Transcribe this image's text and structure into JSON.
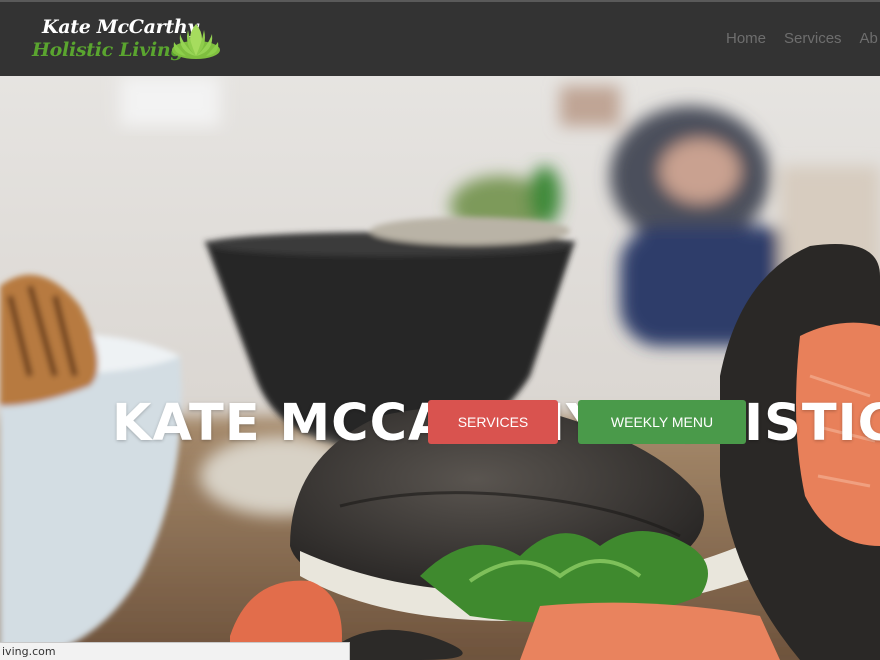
{
  "navbar": {
    "logo_line1": "Kate McCarthy",
    "logo_line2": "Holistic Living",
    "links": [
      "Home",
      "Services",
      "Ab"
    ]
  },
  "hero": {
    "title": "KATE MCCARTHY HOLISTIC",
    "buttons": {
      "services": "SERVICES",
      "weekly_menu": "WEEKLY MENU"
    }
  },
  "status_bar": {
    "url": "iving.com"
  },
  "colors": {
    "navbar_bg": "#333333",
    "logo_green": "#5aa52f",
    "services_button": "#d9534f",
    "menu_button": "#4a9a4a"
  },
  "icons": {
    "logo": "lotus-icon"
  }
}
